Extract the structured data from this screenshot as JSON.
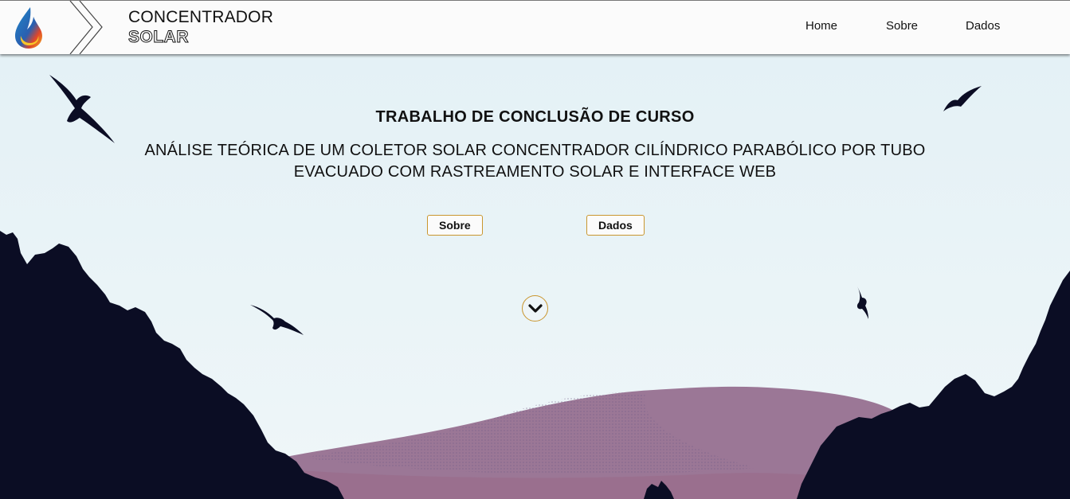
{
  "header": {
    "brand_line1": "CONCENTRADOR",
    "brand_line2": "SOLAR",
    "logo_icon": "water-drop-icon",
    "divider_icon": "double-chevron-icon",
    "nav": [
      {
        "label": "Home"
      },
      {
        "label": "Sobre"
      },
      {
        "label": "Dados"
      }
    ]
  },
  "hero": {
    "title": "TRABALHO DE CONCLUSÃO DE CURSO",
    "subtitle": "ANÁLISE TEÓRICA DE UM COLETOR SOLAR CONCENTRADOR CILÍNDRICO PARABÓLICO POR TUBO EVACUADO COM RASTREAMENTO SOLAR E INTERFACE WEB",
    "buttons": [
      {
        "label": "Sobre"
      },
      {
        "label": "Dados"
      }
    ],
    "scroll_icon": "chevron-down-icon"
  },
  "colors": {
    "accent_border": "#c9962f",
    "forest": "#0b0d24",
    "mountain": "#9a7694",
    "sky_top": "#e6f2f7"
  }
}
